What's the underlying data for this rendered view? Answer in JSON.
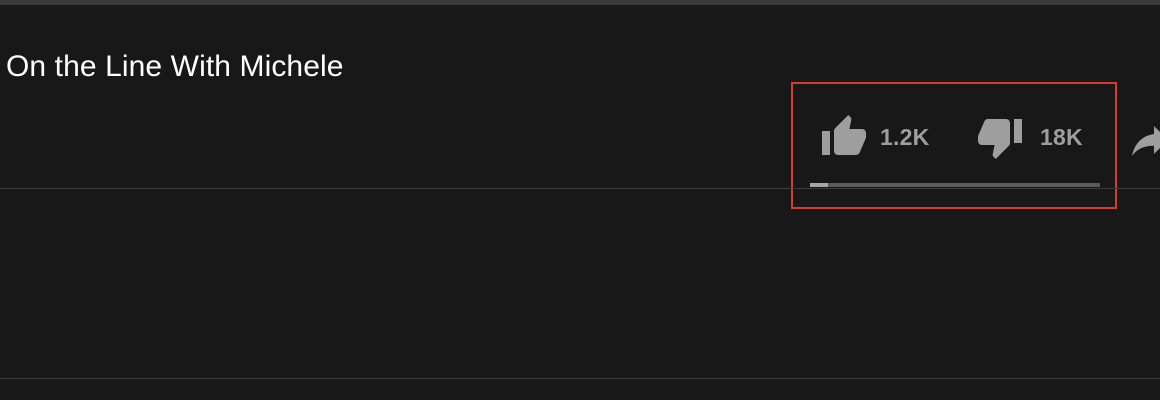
{
  "video": {
    "title": "On the Line With Michele"
  },
  "ratings": {
    "like_count": "1.2K",
    "dislike_count": "18K",
    "like_ratio": 0.0625,
    "like_icon": "thumbs-up-icon",
    "dislike_icon": "thumbs-down-icon"
  },
  "share": {
    "icon": "share-arrow-icon"
  },
  "colors": {
    "background": "#181818",
    "icon": "#9e9e9e",
    "sentiment_fill": "#a6a6a6",
    "sentiment_track": "#5a5a5a",
    "highlight": "#d63b2c"
  }
}
